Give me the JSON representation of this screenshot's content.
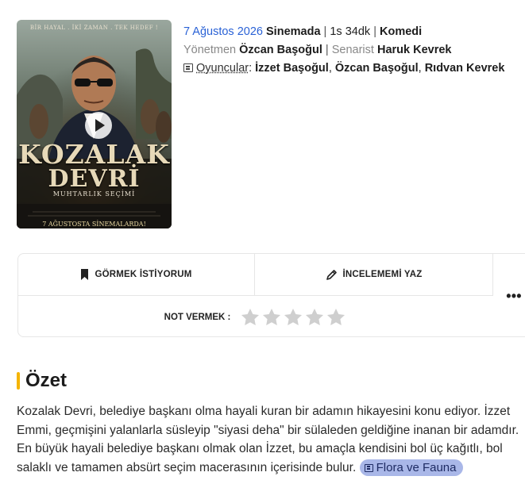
{
  "poster": {
    "tagline": "BİR HAYAL . İKİ ZAMAN . TEK HEDEF !",
    "title_line1": "KOZALAK",
    "title_line2": "DEVRİ",
    "subtitle": "MUHTARLIK SEÇİMİ",
    "release_banner": "7 AĞUSTOSTA SİNEMALARDA!"
  },
  "meta": {
    "date": "7 Ağustos 2026",
    "status": "Sinemada",
    "duration": "1s 34dk",
    "genre": "Komedi",
    "director_label": "Yönetmen",
    "director": "Özcan Başoğul",
    "writer_label": "Senarist",
    "writer": "Haruk Kevrek",
    "cast_label": "Oyuncular",
    "cast": [
      "İzzet Başoğul",
      "Özcan Başoğul",
      "Rıdvan Kevrek"
    ]
  },
  "actions": {
    "want_label": "GÖRMEK İSTİYORUM",
    "review_label": "İNCELEMEMİ YAZ",
    "more_label": "•••",
    "rating_label": "NOT VERMEK :",
    "rating_value": 0,
    "rating_max": 5
  },
  "summary": {
    "title": "Özet",
    "text": "Kozalak Devri, belediye başkanı olma hayali kuran bir adamın hikayesini konu ediyor. İzzet Emmi, geçmişini yalanlarla süsleyip \"siyasi deha\" bir sülaleden geldiğine inanan bir adamdır. En büyük hayali belediye başkanı olmak olan İzzet, bu amaçla kendisini bol üç kağıtlı, bol salaklı ve tamamen absürt seçim macerasının içerisinde bulur.",
    "tag": "Flora ve Fauna"
  },
  "colors": {
    "accent_blue": "#2a62d6",
    "section_bar": "#f5b400",
    "tag_bg": "#a9b7e8",
    "star_empty": "#cfcfcf"
  }
}
